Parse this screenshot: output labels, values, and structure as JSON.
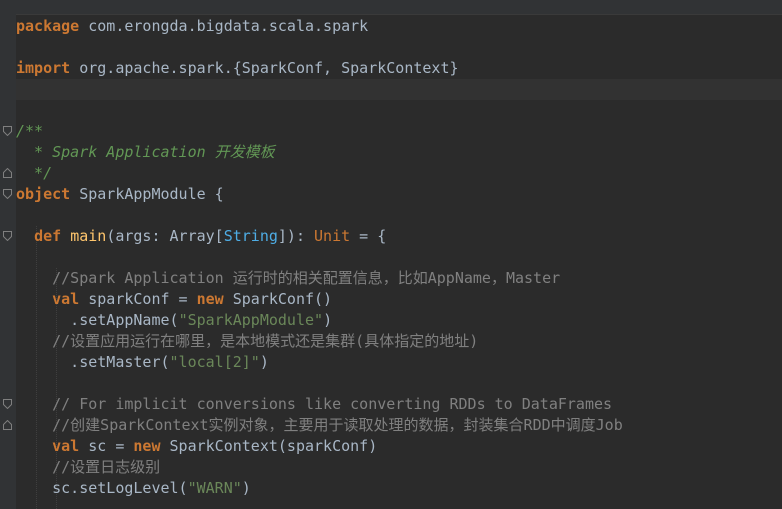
{
  "editor": {
    "lines": [
      {
        "segments": [
          {
            "t": "package",
            "c": "kw"
          },
          {
            "t": " com.erongda.bigdata.scala.spark"
          }
        ]
      },
      {
        "segments": []
      },
      {
        "segments": [
          {
            "t": "import",
            "c": "kw"
          },
          {
            "t": " org.apache.spark.{SparkConf, SparkContext}"
          }
        ]
      },
      {
        "segments": []
      },
      {
        "segments": []
      },
      {
        "segments": [
          {
            "t": "/**",
            "c": "doc"
          }
        ]
      },
      {
        "segments": [
          {
            "t": "  * Spark Application 开发模板",
            "c": "doc"
          }
        ]
      },
      {
        "segments": [
          {
            "t": "  */",
            "c": "doc"
          }
        ]
      },
      {
        "segments": [
          {
            "t": "object",
            "c": "kw"
          },
          {
            "t": " SparkAppModule {"
          }
        ]
      },
      {
        "segments": []
      },
      {
        "segments": [
          {
            "t": "  "
          },
          {
            "t": "def",
            "c": "kw"
          },
          {
            "t": " "
          },
          {
            "t": "main",
            "c": "fn"
          },
          {
            "t": "(args: Array["
          },
          {
            "t": "String",
            "c": "tparam"
          },
          {
            "t": "]): "
          },
          {
            "t": "Unit",
            "c": "typ"
          },
          {
            "t": " = {"
          }
        ]
      },
      {
        "segments": []
      },
      {
        "segments": [
          {
            "t": "    //Spark Application 运行时的相关配置信息，比如AppName，Master",
            "c": "cmt"
          }
        ]
      },
      {
        "segments": [
          {
            "t": "    "
          },
          {
            "t": "val",
            "c": "kw"
          },
          {
            "t": " sparkConf = "
          },
          {
            "t": "new",
            "c": "kw"
          },
          {
            "t": " SparkConf()"
          }
        ]
      },
      {
        "segments": [
          {
            "t": "      .setAppName("
          },
          {
            "t": "\"SparkAppModule\"",
            "c": "str"
          },
          {
            "t": ")"
          }
        ]
      },
      {
        "segments": [
          {
            "t": "    //设置应用运行在哪里，是本地模式还是集群(具体指定的地址)",
            "c": "cmt"
          }
        ]
      },
      {
        "segments": [
          {
            "t": "      .setMaster("
          },
          {
            "t": "\"local[2]\"",
            "c": "str"
          },
          {
            "t": ")"
          }
        ]
      },
      {
        "segments": []
      },
      {
        "segments": [
          {
            "t": "    // For implicit conversions like converting RDDs to DataFrames",
            "c": "cmt"
          }
        ]
      },
      {
        "segments": [
          {
            "t": "    //创建SparkContext实例对象，主要用于读取处理的数据，封装集合RDD中调度Job",
            "c": "cmt"
          }
        ]
      },
      {
        "segments": [
          {
            "t": "    "
          },
          {
            "t": "val",
            "c": "kw"
          },
          {
            "t": " sc = "
          },
          {
            "t": "new",
            "c": "kw"
          },
          {
            "t": " SparkContext(sparkConf)"
          }
        ]
      },
      {
        "segments": [
          {
            "t": "    //设置日志级别",
            "c": "cmt"
          }
        ]
      },
      {
        "segments": [
          {
            "t": "    sc.setLogLevel("
          },
          {
            "t": "\"WARN\"",
            "c": "str"
          },
          {
            "t": ")"
          }
        ]
      }
    ]
  }
}
